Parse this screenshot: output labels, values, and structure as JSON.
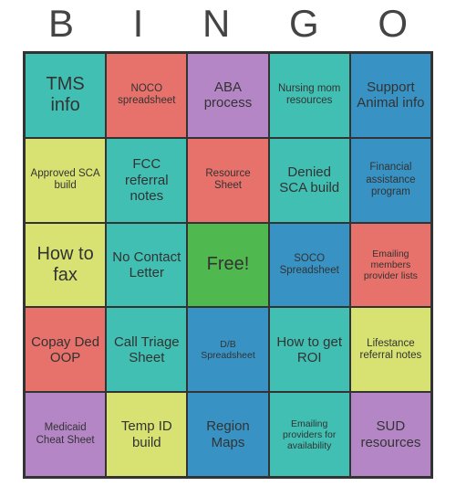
{
  "title_letters": [
    "B",
    "I",
    "N",
    "G",
    "O"
  ],
  "cells": [
    {
      "text": "TMS info",
      "color": "teal",
      "size": "lg"
    },
    {
      "text": "NOCO spreadsheet",
      "color": "red",
      "size": "sm"
    },
    {
      "text": "ABA process",
      "color": "purple",
      "size": "md"
    },
    {
      "text": "Nursing mom resources",
      "color": "teal",
      "size": "sm"
    },
    {
      "text": "Support Animal info",
      "color": "blue",
      "size": "md"
    },
    {
      "text": "Approved SCA build",
      "color": "yellow",
      "size": "sm"
    },
    {
      "text": "FCC referral notes",
      "color": "teal",
      "size": "md"
    },
    {
      "text": "Resource Sheet",
      "color": "red",
      "size": "sm"
    },
    {
      "text": "Denied SCA build",
      "color": "teal",
      "size": "md"
    },
    {
      "text": "Financial assistance program",
      "color": "blue",
      "size": "sm"
    },
    {
      "text": "How to fax",
      "color": "yellow",
      "size": "lg"
    },
    {
      "text": "No Contact Letter",
      "color": "teal",
      "size": "md"
    },
    {
      "text": "Free!",
      "color": "green",
      "size": "lg"
    },
    {
      "text": "SOCO Spreadsheet",
      "color": "blue",
      "size": "sm"
    },
    {
      "text": "Emailing members provider lists",
      "color": "red",
      "size": "xs"
    },
    {
      "text": "Copay Ded OOP",
      "color": "red",
      "size": "md"
    },
    {
      "text": "Call Triage Sheet",
      "color": "teal",
      "size": "md"
    },
    {
      "text": "D/B Spreadsheet",
      "color": "blue",
      "size": "xs"
    },
    {
      "text": "How to get ROI",
      "color": "teal",
      "size": "md"
    },
    {
      "text": "Lifestance referral notes",
      "color": "yellow",
      "size": "sm"
    },
    {
      "text": "Medicaid Cheat Sheet",
      "color": "purple",
      "size": "sm"
    },
    {
      "text": "Temp ID build",
      "color": "yellow",
      "size": "md"
    },
    {
      "text": "Region Maps",
      "color": "blue",
      "size": "md"
    },
    {
      "text": "Emailing providers for availability",
      "color": "teal",
      "size": "xs"
    },
    {
      "text": "SUD resources",
      "color": "purple",
      "size": "md"
    }
  ]
}
